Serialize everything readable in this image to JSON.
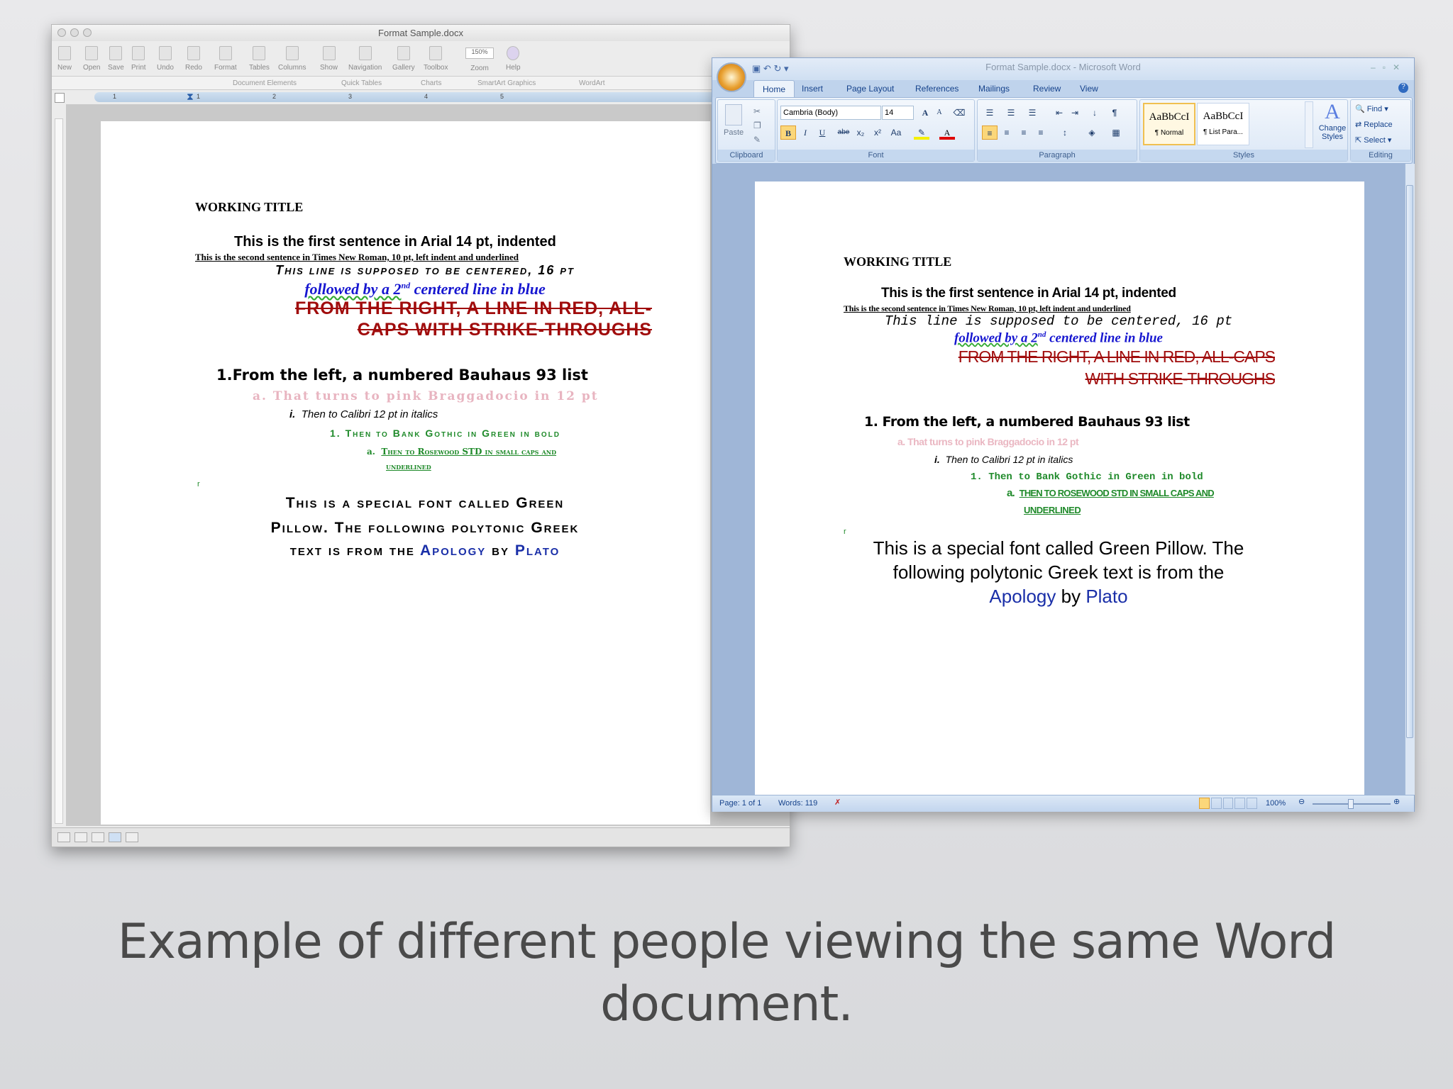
{
  "mac": {
    "title": "Format Sample.docx",
    "toolbar": [
      "New",
      "Open",
      "Save",
      "Print",
      "Undo",
      "Redo",
      "Format",
      "Tables",
      "Columns",
      "Show",
      "Navigation",
      "Gallery",
      "Toolbox",
      "Zoom",
      "Help"
    ],
    "zoom_value": "150%",
    "gallery_tabs": [
      "Document Elements",
      "Quick Tables",
      "Charts",
      "SmartArt Graphics",
      "WordArt"
    ],
    "ruler_numbers": [
      "1",
      "1",
      "2",
      "3",
      "4",
      "5"
    ]
  },
  "word": {
    "title": "Format Sample.docx - Microsoft Word",
    "tabs": [
      "Home",
      "Insert",
      "Page Layout",
      "References",
      "Mailings",
      "Review",
      "View"
    ],
    "clipboard": {
      "paste": "Paste",
      "label": "Clipboard"
    },
    "font": {
      "name": "Cambria (Body)",
      "size": "14",
      "label": "Font",
      "bold": "B",
      "italic": "I",
      "underline": "U",
      "strike": "abe",
      "sub": "x₂",
      "sup": "x²",
      "case": "Aa",
      "grow": "A",
      "shrink": "A"
    },
    "paragraph": {
      "label": "Paragraph"
    },
    "styles": {
      "label": "Styles",
      "items": [
        {
          "preview": "AaBbCcI",
          "name": "¶ Normal"
        },
        {
          "preview": "AaBbCcI",
          "name": "¶ List Para..."
        }
      ],
      "change": "Change Styles"
    },
    "editing": {
      "label": "Editing",
      "find": "Find",
      "replace": "Replace",
      "select": "Select"
    },
    "status": {
      "page": "Page: 1 of 1",
      "words": "Words: 119",
      "zoom": "100%"
    }
  },
  "doc": {
    "working_title": "WORKING TITLE",
    "line1": "This is the first sentence in Arial 14 pt, indented",
    "line2": "This is the second sentence in Times New Roman, 10 pt, left indent and underlined",
    "line3": "This line is supposed to be centered, 16 pt",
    "line4a": "followed by a 2",
    "line4sup": "nd",
    "line4b": " centered line in blue",
    "red_mac": [
      "FROM THE RIGHT, A LINE IN RED, ALL-",
      "CAPS WITH STRIKE-THROUGHS"
    ],
    "red_win": [
      "FROM THE RIGHT, A LINE IN RED, ALL-CAPS",
      "WITH STRIKE-THROUGHS"
    ],
    "list1": "1.From the left, a numbered Bauhaus 93 list",
    "list1_win": "1. From the left, a numbered Bauhaus 93 list",
    "list2": "a. That turns to pink Braggadocio in 12 pt",
    "list3_num": "i.",
    "list3": "Then to Calibri 12 pt in italics",
    "list4": "1. Then to Bank Gothic in Green in bold",
    "list5_num": "a.",
    "list5": [
      "Then to Rosewood STD in small caps and",
      "underlined"
    ],
    "mark": "r",
    "special_mac": [
      "This is a special font called Green",
      "Pillow. The following polytonic Greek",
      "text is from the "
    ],
    "special_win": [
      "This is a special font called Green Pillow. The",
      "following polytonic Greek text is from the"
    ],
    "apology": "Apology",
    "by": " by ",
    "plato": "Plato"
  },
  "caption": [
    "Example of different people viewing the same Word",
    "document."
  ]
}
